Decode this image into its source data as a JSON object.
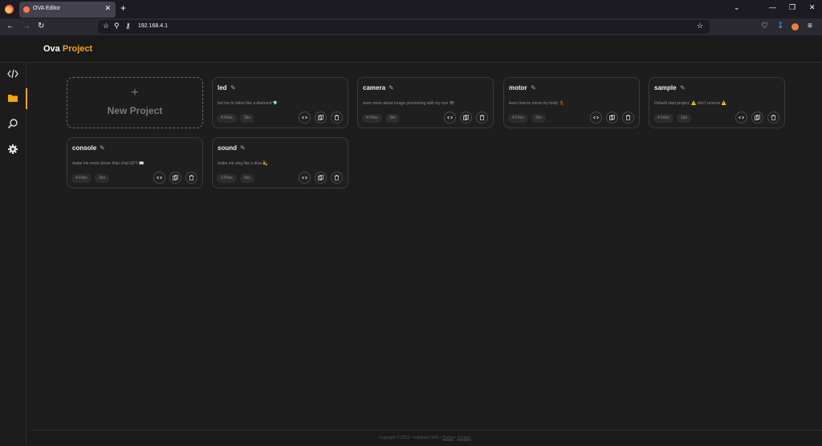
{
  "browser": {
    "tab_title": "OVA Editor",
    "tab_close": "✕",
    "new_tab": "+",
    "url": "192.168.4.1",
    "win_chevron": "⌄",
    "win_min": "—",
    "win_restore": "❐",
    "win_close": "✕"
  },
  "brand": {
    "part1": "Ova",
    "part2": "Project",
    "accent_color": "#f5a60b"
  },
  "sidebar": {
    "items": [
      {
        "icon": "code-icon"
      },
      {
        "icon": "folder-icon",
        "active": true
      },
      {
        "icon": "search-icon"
      },
      {
        "icon": "gear-icon"
      }
    ]
  },
  "new_project": {
    "plus": "+",
    "label": "New Project"
  },
  "projects": [
    {
      "name": "led",
      "description": "led me to shine like a diamond 💎",
      "files": "4 Files",
      "size": "3ko"
    },
    {
      "name": "camera",
      "description": "learn more about image processing with my eye 👁",
      "files": "4 Files",
      "size": "3ko"
    },
    {
      "name": "motor",
      "description": "learn how to move my body 💃",
      "files": "4 Files",
      "size": "2ko"
    },
    {
      "name": "sample",
      "description": "Default start project. ⚠️ don't remove ⚠️",
      "files": "4 Files",
      "size": "1ko"
    },
    {
      "name": "console",
      "description": "make me more clever than chat GPT 📖",
      "files": "4 Files",
      "size": "2ko"
    },
    {
      "name": "sound",
      "description": "make me sing like a diva 💫",
      "files": "3 Files",
      "size": "6ko"
    }
  ],
  "footer": {
    "copyright": "Copyright © 2022 • Issidiotev SAS •",
    "terms": "Terms",
    "sep": "•",
    "contact": "Contact"
  }
}
